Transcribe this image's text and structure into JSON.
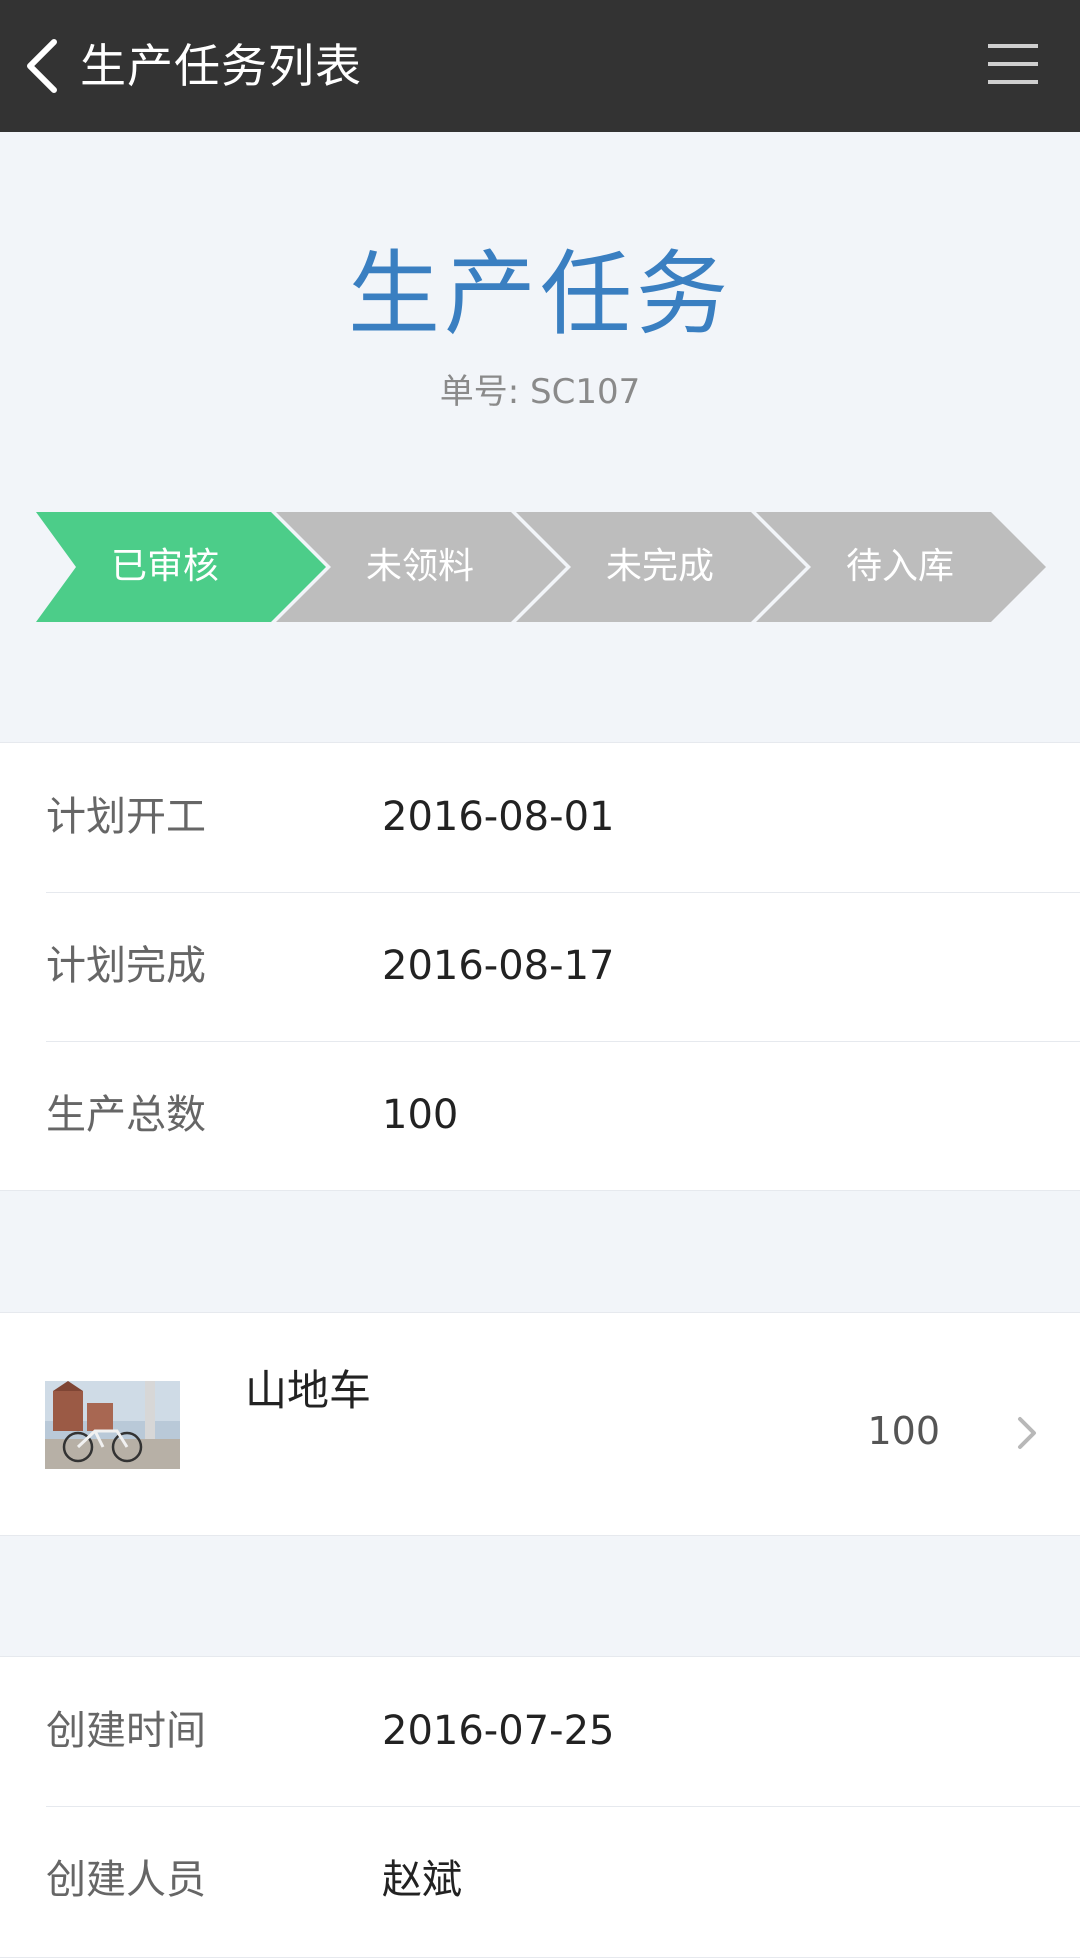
{
  "header": {
    "title": "生产任务列表",
    "back_icon": "chevron-left-icon",
    "menu_icon": "hamburger-menu-icon"
  },
  "summary": {
    "title": "生产任务",
    "order_number": "单号: SC107"
  },
  "progress": {
    "steps": [
      {
        "label": "已审核",
        "state": "done",
        "color": "#4ccd89"
      },
      {
        "label": "未领料",
        "state": "pending",
        "color": "#bdbdbd"
      },
      {
        "label": "未完成",
        "state": "pending",
        "color": "#bdbdbd"
      },
      {
        "label": "待入库",
        "state": "pending",
        "color": "#bdbdbd"
      }
    ]
  },
  "plan": {
    "rows": [
      {
        "label": "计划开工",
        "value": "2016-08-01"
      },
      {
        "label": "计划完成",
        "value": "2016-08-17"
      },
      {
        "label": "生产总数",
        "value": "100"
      }
    ]
  },
  "product": {
    "name": "山地车",
    "quantity": "100",
    "thumbnail_icon": "bicycle-photo",
    "chevron_icon": "chevron-right-icon"
  },
  "meta": {
    "rows": [
      {
        "label": "创建时间",
        "value": "2016-07-25"
      },
      {
        "label": "创建人员",
        "value": "赵斌"
      }
    ]
  },
  "colors": {
    "header_bg": "#333333",
    "title_blue": "#3a7fc1",
    "page_bg": "#f2f5f9",
    "step_done": "#4ccd89",
    "step_pending": "#bdbdbd"
  }
}
